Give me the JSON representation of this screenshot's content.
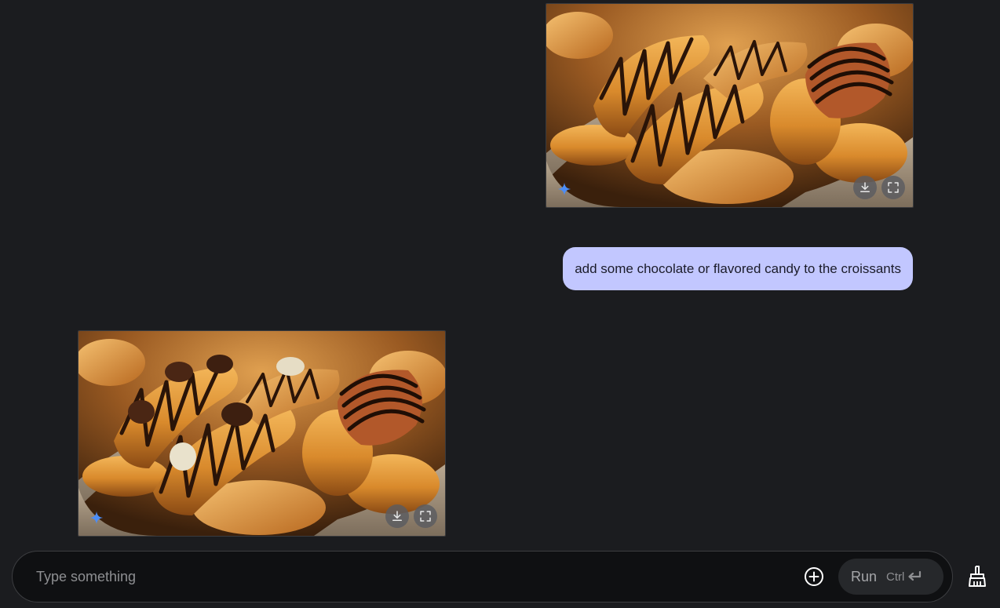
{
  "messages": {
    "model_image_top": {
      "alt": "croissants drizzled with chocolate in a basket",
      "sparkle_icon": "sparkle-icon",
      "download_icon": "download-icon",
      "fullscreen_icon": "fullscreen-icon"
    },
    "user_prompt": {
      "text": "add some chocolate or flavored candy to the croissants"
    },
    "model_image_bottom": {
      "alt": "croissants drizzled with chocolate and topped with candy in a basket",
      "sparkle_icon": "sparkle-icon",
      "download_icon": "download-icon",
      "fullscreen_icon": "fullscreen-icon"
    }
  },
  "composer": {
    "placeholder": "Type something",
    "value": "",
    "add_icon": "add-circle-icon",
    "run_label": "Run",
    "run_shortcut": "Ctrl",
    "enter_icon": "enter-key-icon"
  },
  "clear_icon": "broom-icon",
  "colors": {
    "background": "#1b1c1f",
    "user_bubble": "#c2c7ff",
    "composer_bg": "#0f1012",
    "run_button_bg": "#26282b",
    "sparkle": "#4c8df6"
  }
}
